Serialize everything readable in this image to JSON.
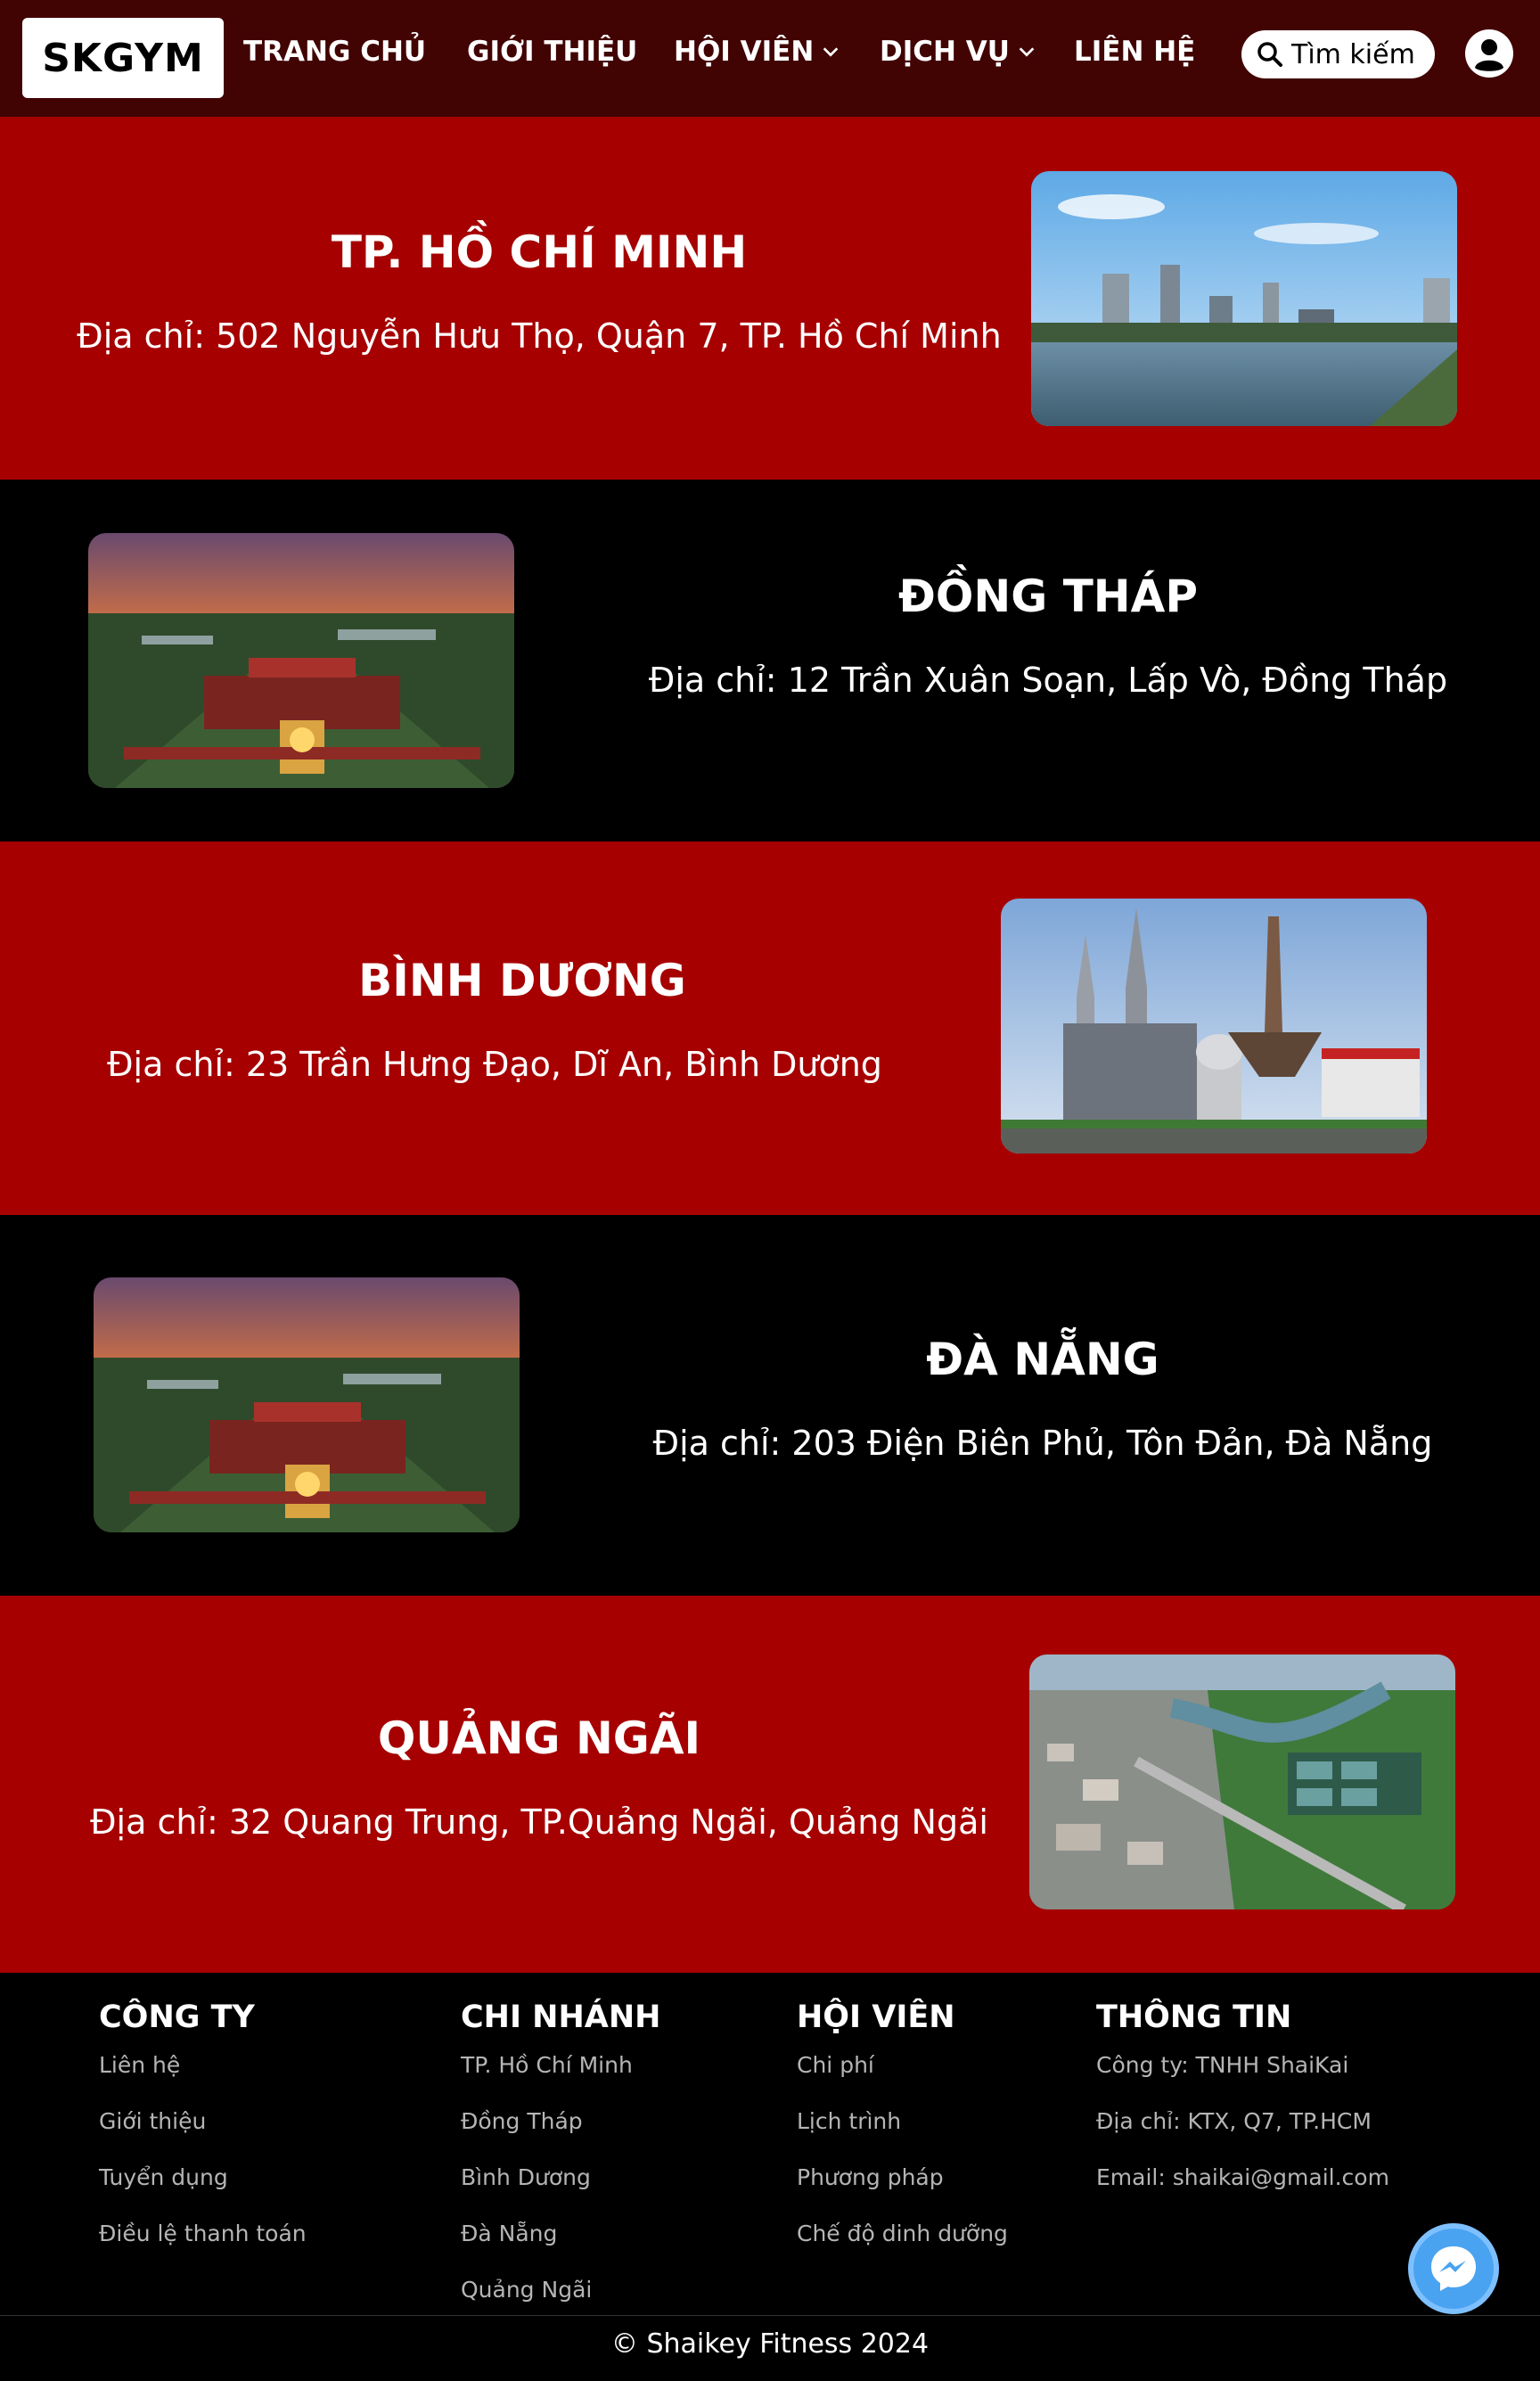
{
  "header": {
    "logo": "SKGYM",
    "nav": [
      {
        "label": "TRANG CHỦ"
      },
      {
        "label": "GIỚI THIỆU"
      },
      {
        "label": "HỘI VIÊN"
      },
      {
        "label": "DỊCH VỤ"
      },
      {
        "label": "LIÊN HỆ"
      }
    ],
    "search_label": "Tìm kiếm"
  },
  "branches": [
    {
      "title": "TP. HỒ CHÍ MINH",
      "address": "Địa chỉ: 502 Nguyễn Hưu Thọ, Quận 7, TP. Hồ Chí Minh"
    },
    {
      "title": "ĐỒNG THÁP",
      "address": "Địa chỉ: 12 Trần Xuân Soạn, Lấp Vò, Đồng Tháp"
    },
    {
      "title": "BÌNH DƯƠNG",
      "address": "Địa chỉ: 23 Trần Hưng Đạo, Dĩ An, Bình Dương"
    },
    {
      "title": "ĐÀ NẴNG",
      "address": "Địa chỉ: 203 Điện Biên Phủ, Tôn Đản, Đà Nẵng"
    },
    {
      "title": "QUẢNG NGÃI",
      "address": "Địa chỉ: 32 Quang Trung, TP.Quảng Ngãi, Quảng Ngãi"
    }
  ],
  "footer": {
    "columns": [
      {
        "heading": "CÔNG TY",
        "links": [
          "Liên hệ",
          "Giới thiệu",
          "Tuyển dụng",
          "Điều lệ thanh toán"
        ]
      },
      {
        "heading": "CHI NHÁNH",
        "links": [
          "TP. Hồ Chí Minh",
          "Đồng Tháp",
          "Bình Dương",
          "Đà Nẵng",
          "Quảng Ngãi"
        ]
      },
      {
        "heading": "HỘI VIÊN",
        "links": [
          "Chi phí",
          "Lịch trình",
          "Phương pháp",
          "Chế độ dinh dưỡng"
        ]
      },
      {
        "heading": "THÔNG TIN",
        "links": [
          "Công ty: TNHH ShaiKai",
          "Địa chỉ: KTX, Q7, TP.HCM",
          "Email: shaikai@gmail.com"
        ]
      }
    ],
    "copyright": "© Shaikey Fitness 2024"
  },
  "colors": {
    "header_bg": "#420303",
    "red_section": "#a60000",
    "black_section": "#000000",
    "messenger": "#4aa3f0"
  },
  "icons": {
    "search": "search-icon",
    "user": "user-icon",
    "messenger": "messenger-icon",
    "chevron": "chevron-down-icon"
  }
}
